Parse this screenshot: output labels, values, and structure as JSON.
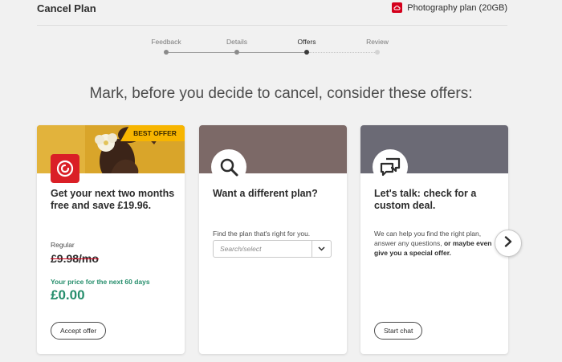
{
  "header": {
    "title": "Cancel Plan",
    "plan_name": "Photography plan (20GB)",
    "plan_icon": "creative-cloud-icon"
  },
  "stepper": {
    "steps": [
      "Feedback",
      "Details",
      "Offers",
      "Review"
    ],
    "current_step": "Offers"
  },
  "headline": "Mark, before you decide to cancel, consider these offers:",
  "offers": [
    {
      "badge": "BEST OFFER",
      "title": "Get your next two months free and save £19.96.",
      "regular_label": "Regular",
      "regular_price": "£9.98/mo",
      "promo_label": "Your price for the next 60 days",
      "promo_price": "£0.00",
      "button": "Accept offer",
      "icon": "creative-cloud-icon"
    },
    {
      "title": "Want a different plan?",
      "body": "Find the plan that's right for you.",
      "select_placeholder": "Search/select",
      "icon": "search-icon"
    },
    {
      "title": "Let's talk: check for a custom deal.",
      "body_parts": [
        "We can help you find the right plan, answer any questions, ",
        "or maybe even give you a special offer."
      ],
      "button": "Start chat",
      "icon": "chat-icon"
    }
  ],
  "colors": {
    "accent_green": "#268e6c",
    "brand_red": "#da1f26",
    "badge_yellow": "#f7b500"
  }
}
